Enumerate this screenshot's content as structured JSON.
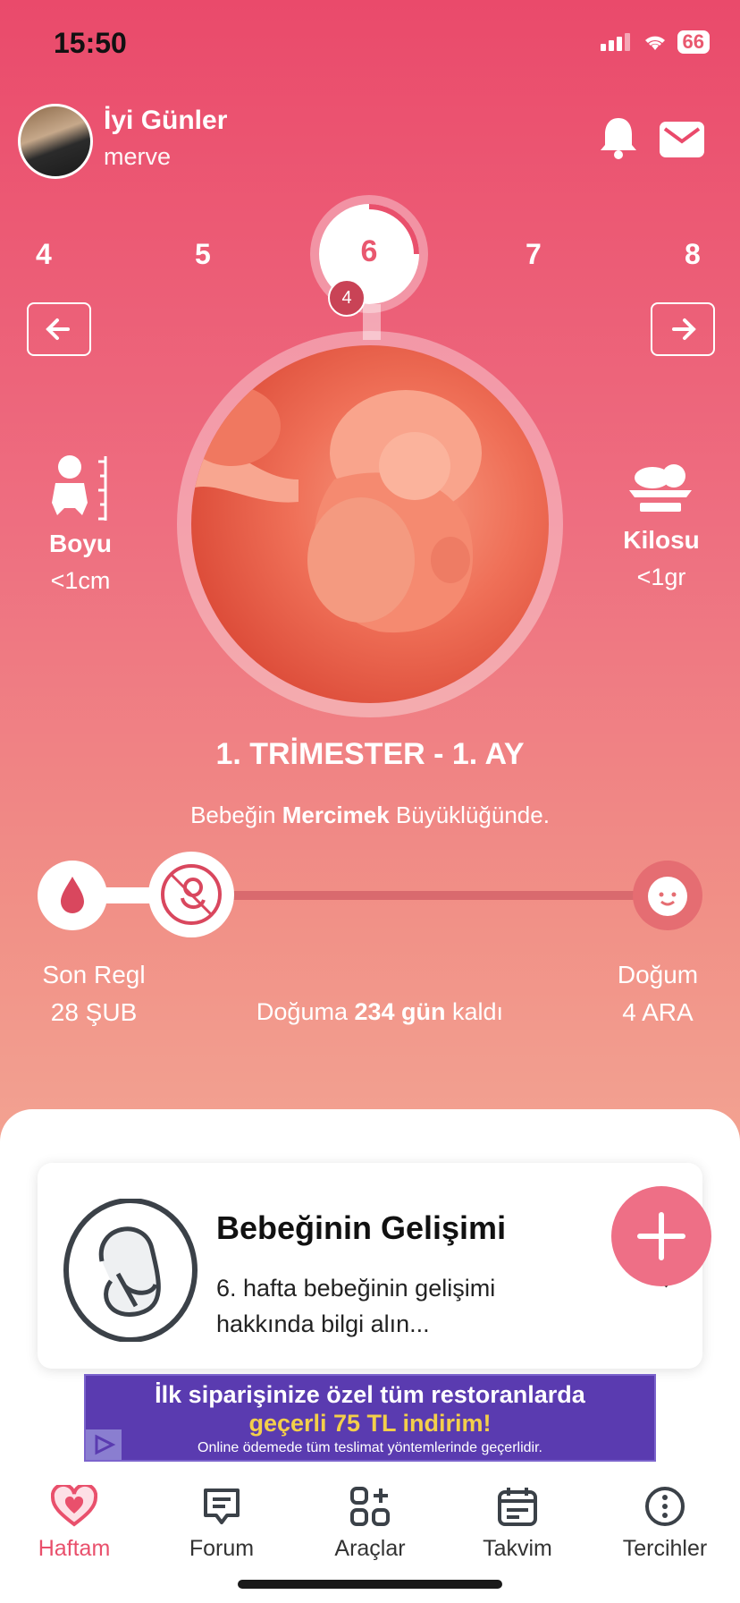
{
  "status": {
    "time": "15:50",
    "battery": "66"
  },
  "header": {
    "greeting": "İyi Günler",
    "username": "merve"
  },
  "weeks": {
    "items": [
      "4",
      "5",
      "6",
      "7",
      "8"
    ],
    "selected": "6",
    "badge": "4"
  },
  "stats": {
    "length_label": "Boyu",
    "length_value": "<1cm",
    "weight_label": "Kilosu",
    "weight_value": "<1gr"
  },
  "trimester": "1. TRİMESTER - 1. AY",
  "size": {
    "prefix": "Bebeğin ",
    "fruit": "Mercimek",
    "suffix": " Büyüklüğünde."
  },
  "timeline": {
    "start_label": "Son Regl",
    "start_date": "28 ŞUB",
    "end_label": "Doğum",
    "end_date": "4 ARA",
    "remaining_prefix": "Doğuma ",
    "remaining_days": "234 gün",
    "remaining_suffix": " kaldı",
    "progress": 0.2
  },
  "card": {
    "title": "Bebeğinin Gelişimi",
    "description": "6. hafta bebeğinin gelişimi hakkında bilgi alın..."
  },
  "ad": {
    "line1": "İlk siparişinize özel tüm restoranlarda",
    "line2": "geçerli 75 TL indirim!",
    "line3": "Online ödemede tüm teslimat yöntemlerinde geçerlidir."
  },
  "tabs": [
    "Haftam",
    "Forum",
    "Araçlar",
    "Takvim",
    "Tercihler"
  ],
  "colors": {
    "accent": "#e9506c",
    "hero_top": "#ea4a6b",
    "hero_bottom": "#f3a392"
  }
}
